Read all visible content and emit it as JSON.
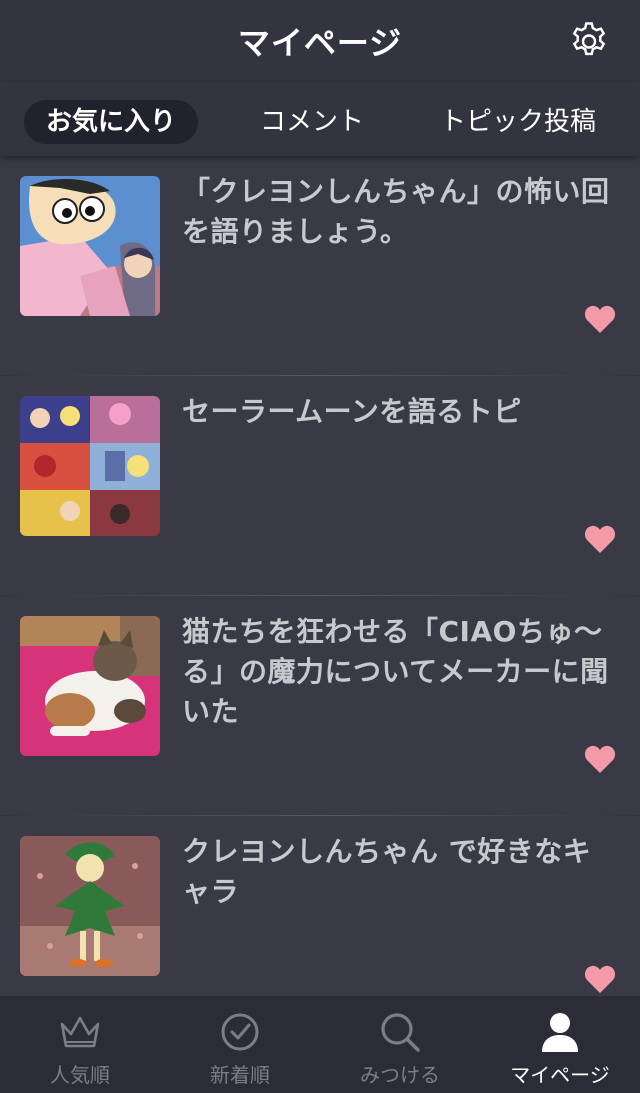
{
  "header": {
    "title": "マイページ",
    "settings_icon": "gear-icon"
  },
  "tabs": [
    {
      "label": "お気に入り",
      "active": true
    },
    {
      "label": "コメント",
      "active": false
    },
    {
      "label": "トピック投稿",
      "active": false
    }
  ],
  "items": [
    {
      "title": "「クレヨンしんちゃん」の怖い回を語りましょう。",
      "favorited": true
    },
    {
      "title": "セーラームーンを語るトピ",
      "favorited": true
    },
    {
      "title": "猫たちを狂わせる「CIAOちゅ〜る」の魔力についてメーカーに聞いた",
      "favorited": true
    },
    {
      "title": "クレヨンしんちゃん で好きなキャラ",
      "favorited": true
    }
  ],
  "bottom_nav": [
    {
      "label": "人気順",
      "icon": "crown-icon",
      "active": false
    },
    {
      "label": "新着順",
      "icon": "clock-icon",
      "active": false
    },
    {
      "label": "みつける",
      "icon": "search-icon",
      "active": false
    },
    {
      "label": "マイページ",
      "icon": "person-icon",
      "active": true
    }
  ],
  "colors": {
    "background": "#3a3a47",
    "header": "#343440",
    "active_tab": "#22222e",
    "heart": "#f49aa8",
    "nav_bg": "#2c2c38",
    "nav_inactive": "#7d7d8a"
  }
}
